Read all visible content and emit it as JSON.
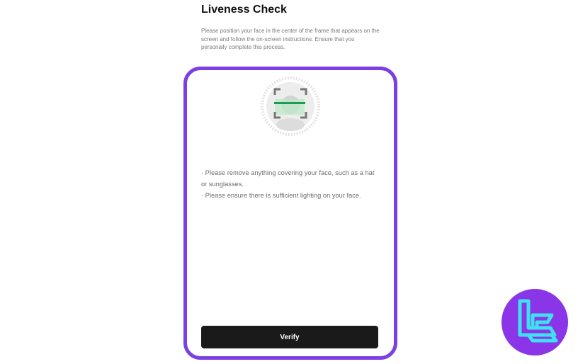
{
  "page": {
    "title": "Liveness Check",
    "description": "Please position your face in the center of the frame that appears on the screen and follow the on-screen instructions. Ensure that you personally complete this process."
  },
  "camera": {
    "icon": "face-scan-icon"
  },
  "instructions": [
    "· Please remove anything covering your face, such as a hat or sunglasses.",
    "· Please ensure there is sufficient lighting on your face."
  ],
  "actions": {
    "verify_label": "Verify"
  },
  "logo": {
    "icon": "brand-logo-icon"
  },
  "colors": {
    "highlight": "#7b3fe4",
    "scan_line": "#1a9e55",
    "button": "#1a1a1a",
    "logo_bg": "#8a35e8",
    "logo_mark": "#3fe0f0"
  }
}
